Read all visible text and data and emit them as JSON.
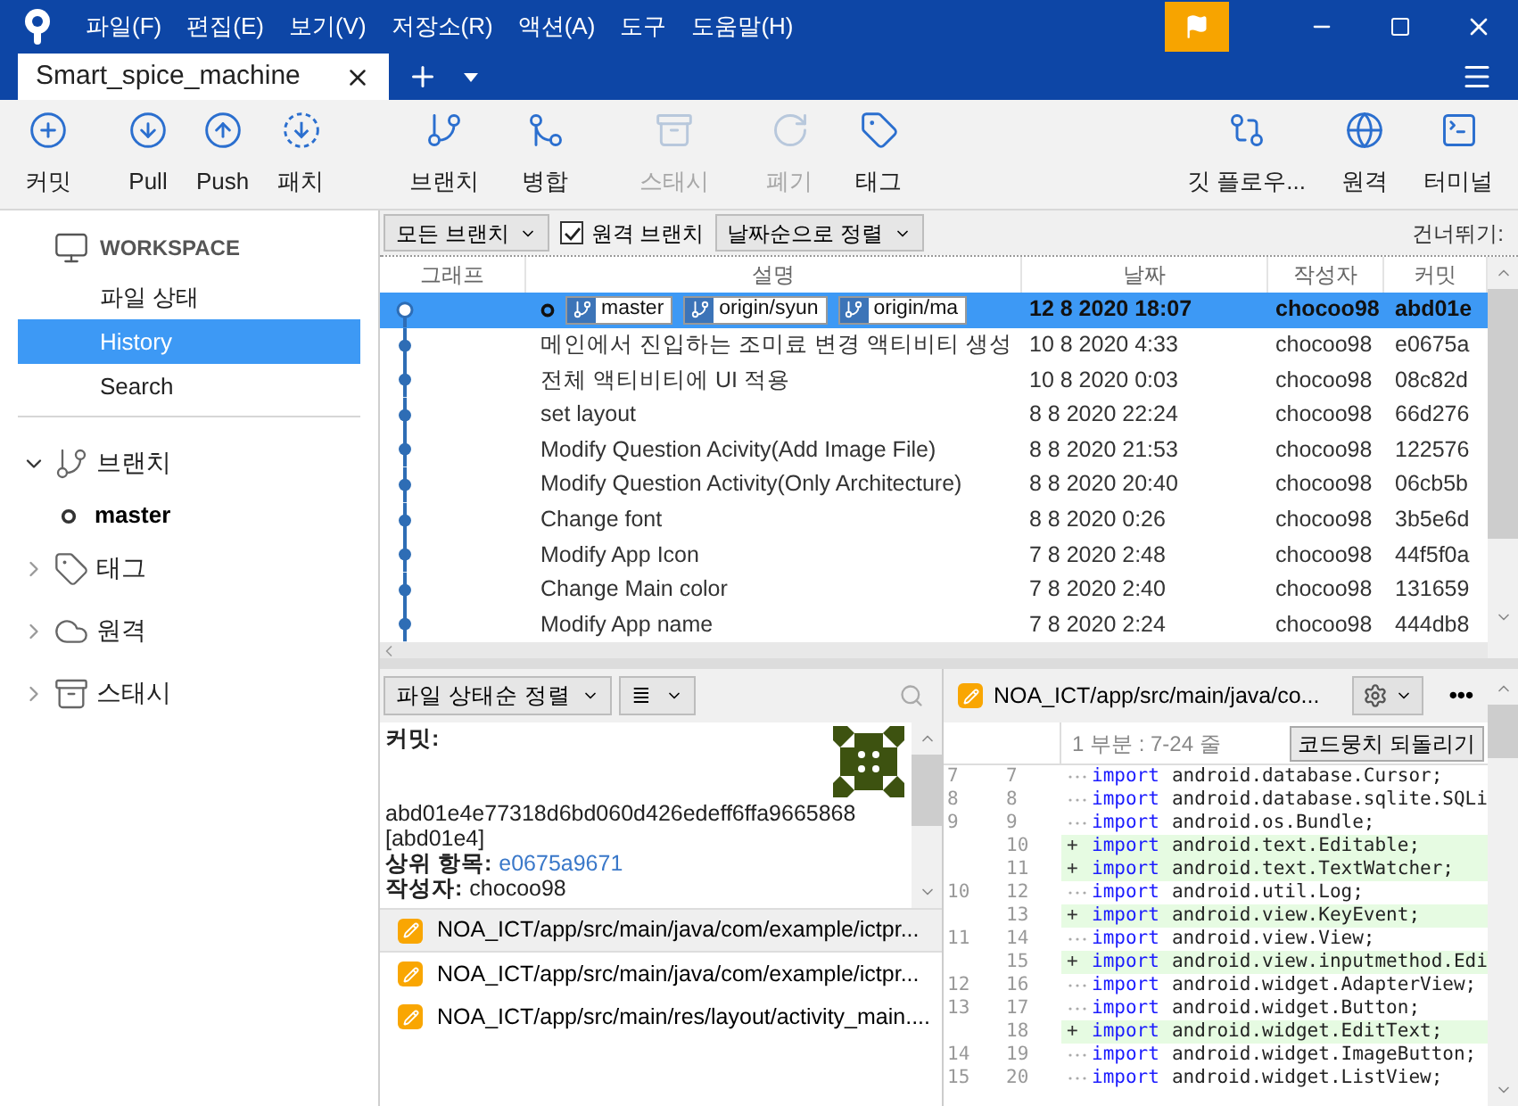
{
  "menu": [
    "파일(F)",
    "편집(E)",
    "보기(V)",
    "저장소(R)",
    "액션(A)",
    "도구",
    "도움말(H)"
  ],
  "tabs": [
    {
      "label": "Smart_spice_machine",
      "selected": true
    }
  ],
  "toolbar": [
    {
      "label": "커밋",
      "disabled": false
    },
    {
      "label": "Pull",
      "disabled": false
    },
    {
      "label": "Push",
      "disabled": false
    },
    {
      "label": "패치",
      "disabled": false
    },
    {
      "label": "브랜치",
      "disabled": false
    },
    {
      "label": "병합",
      "disabled": false
    },
    {
      "label": "스태시",
      "disabled": true
    },
    {
      "label": "폐기",
      "disabled": true
    },
    {
      "label": "태그",
      "disabled": false
    },
    {
      "label": "깃 플로우...",
      "disabled": false
    },
    {
      "label": "원격",
      "disabled": false
    },
    {
      "label": "터미널",
      "disabled": false
    }
  ],
  "sidebar": {
    "workspace": "WORKSPACE",
    "items": [
      {
        "label": "파일 상태",
        "selected": false
      },
      {
        "label": "History",
        "selected": true
      },
      {
        "label": "Search",
        "selected": false
      }
    ],
    "sections": [
      {
        "label": "브랜치",
        "expanded": true,
        "children": [
          {
            "label": "master",
            "current": true
          }
        ]
      },
      {
        "label": "태그",
        "expanded": false
      },
      {
        "label": "원격",
        "expanded": false
      },
      {
        "label": "스태시",
        "expanded": false
      }
    ]
  },
  "filters": {
    "branches": "모든 브랜치",
    "remote": {
      "label": "원격 브랜치",
      "checked": true
    },
    "sort": "날짜순으로 정렬",
    "skip": "건너뛰기:"
  },
  "log": {
    "columns": [
      "그래프",
      "설명",
      "날짜",
      "작성자",
      "커밋"
    ],
    "rows": [
      {
        "refs": [
          "master",
          "origin/syun",
          "origin/ma"
        ],
        "description": "",
        "date": "12 8 2020 18:07",
        "author": "chocoo98",
        "commit": "abd01e",
        "selected": true
      },
      {
        "description": "메인에서 진입하는 조미료 변경 액티비티 생성",
        "date": "10 8 2020 4:33",
        "author": "chocoo98",
        "commit": "e0675a",
        "selected": false
      },
      {
        "description": "전체 액티비티에 UI 적용",
        "date": "10 8 2020 0:03",
        "author": "chocoo98",
        "commit": "08c82d",
        "selected": false
      },
      {
        "description": "set layout",
        "date": "8 8 2020 22:24",
        "author": "chocoo98",
        "commit": "66d276",
        "selected": false
      },
      {
        "description": "Modify Question Acivity(Add Image File)",
        "date": "8 8 2020 21:53",
        "author": "chocoo98",
        "commit": "122576",
        "selected": false
      },
      {
        "description": "Modify Question Activity(Only Architecture)",
        "date": "8 8 2020 20:40",
        "author": "chocoo98",
        "commit": "06cb5b",
        "selected": false
      },
      {
        "description": "Change font",
        "date": "8 8 2020 0:26",
        "author": "chocoo98",
        "commit": "3b5e6d",
        "selected": false
      },
      {
        "description": "Modify App Icon",
        "date": "7 8 2020 2:48",
        "author": "chocoo98",
        "commit": "44f5f0a",
        "selected": false
      },
      {
        "description": "Change Main color",
        "date": "7 8 2020 2:40",
        "author": "chocoo98",
        "commit": "131659",
        "selected": false
      },
      {
        "description": "Modify App name",
        "date": "7 8 2020 2:24",
        "author": "chocoo98",
        "commit": "444db8",
        "selected": false
      }
    ]
  },
  "files_panel": {
    "sort": "파일 상태순 정렬",
    "view": "≣",
    "details": {
      "commit_label": "커밋:",
      "hash": "abd01e4e77318d6bd060d426edeff6ffa9665868",
      "short": "[abd01e4]",
      "parent_label": "상위 항목:",
      "parent": "e0675a9671",
      "author_label": "작성자:",
      "author": "chocoo98"
    },
    "files": [
      {
        "path": "NOA_ICT/app/src/main/java/com/example/ictpr...",
        "selected": true
      },
      {
        "path": "NOA_ICT/app/src/main/java/com/example/ictpr...",
        "selected": false
      },
      {
        "path": "NOA_ICT/app/src/main/res/layout/activity_main....",
        "selected": false
      }
    ]
  },
  "diff": {
    "file": "NOA_ICT/app/src/main/java/co...",
    "more": "•••",
    "hunk": "1 부분 : 7-24 줄",
    "revert": "코드뭉치 되돌리기",
    "lines": [
      {
        "old": "7",
        "new": "7",
        "kind": "context",
        "keyword": "import",
        "code": "android.database.Cursor;"
      },
      {
        "old": "8",
        "new": "8",
        "kind": "context",
        "keyword": "import",
        "code": "android.database.sqlite.SQLi"
      },
      {
        "old": "9",
        "new": "9",
        "kind": "context",
        "keyword": "import",
        "code": "android.os.Bundle;"
      },
      {
        "new": "10",
        "kind": "added",
        "marker": "+",
        "keyword": "import",
        "code": "android.text.Editable;"
      },
      {
        "new": "11",
        "kind": "added",
        "marker": "+",
        "keyword": "import",
        "code": "android.text.TextWatcher;"
      },
      {
        "old": "10",
        "new": "12",
        "kind": "context",
        "keyword": "import",
        "code": "android.util.Log;"
      },
      {
        "new": "13",
        "kind": "added",
        "marker": "+",
        "keyword": "import",
        "code": "android.view.KeyEvent;"
      },
      {
        "old": "11",
        "new": "14",
        "kind": "context",
        "keyword": "import",
        "code": "android.view.View;"
      },
      {
        "new": "15",
        "kind": "added",
        "marker": "+",
        "keyword": "import",
        "code": "android.view.inputmethod.Edi"
      },
      {
        "old": "12",
        "new": "16",
        "kind": "context",
        "keyword": "import",
        "code": "android.widget.AdapterView;"
      },
      {
        "old": "13",
        "new": "17",
        "kind": "context",
        "keyword": "import",
        "code": "android.widget.Button;"
      },
      {
        "new": "18",
        "kind": "added",
        "marker": "+",
        "keyword": "import",
        "code": "android.widget.EditText;"
      },
      {
        "old": "14",
        "new": "19",
        "kind": "context",
        "keyword": "import",
        "code": "android.widget.ImageButton;"
      },
      {
        "old": "15",
        "new": "20",
        "kind": "context",
        "keyword": "import",
        "code": "android.widget.ListView;"
      }
    ]
  }
}
